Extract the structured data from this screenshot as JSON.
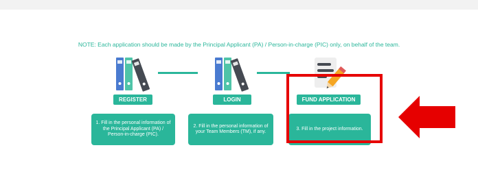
{
  "note": "NOTE: Each application should be made by the Principal Applicant (PA) / Person-in-charge (PIC) only, on behalf of the team.",
  "steps": [
    {
      "button": "REGISTER",
      "description": "1. Fill in the personal information of the Principal Applicant (PA) / Person-in-charge (PIC).",
      "icon": "folders-icon"
    },
    {
      "button": "LOGIN",
      "description": "2. Fill in the personal information of your Team Members (TM), if any.",
      "icon": "folders-icon"
    },
    {
      "button": "FUND APPLICATION",
      "description": "3. Fill in the project information.",
      "icon": "document-pencil-icon"
    }
  ],
  "colors": {
    "accent": "#2ab69a",
    "highlight": "#e60000",
    "folder_blue": "#4a7bd0",
    "folder_green": "#4fc4a8",
    "folder_dark": "#454a52"
  }
}
